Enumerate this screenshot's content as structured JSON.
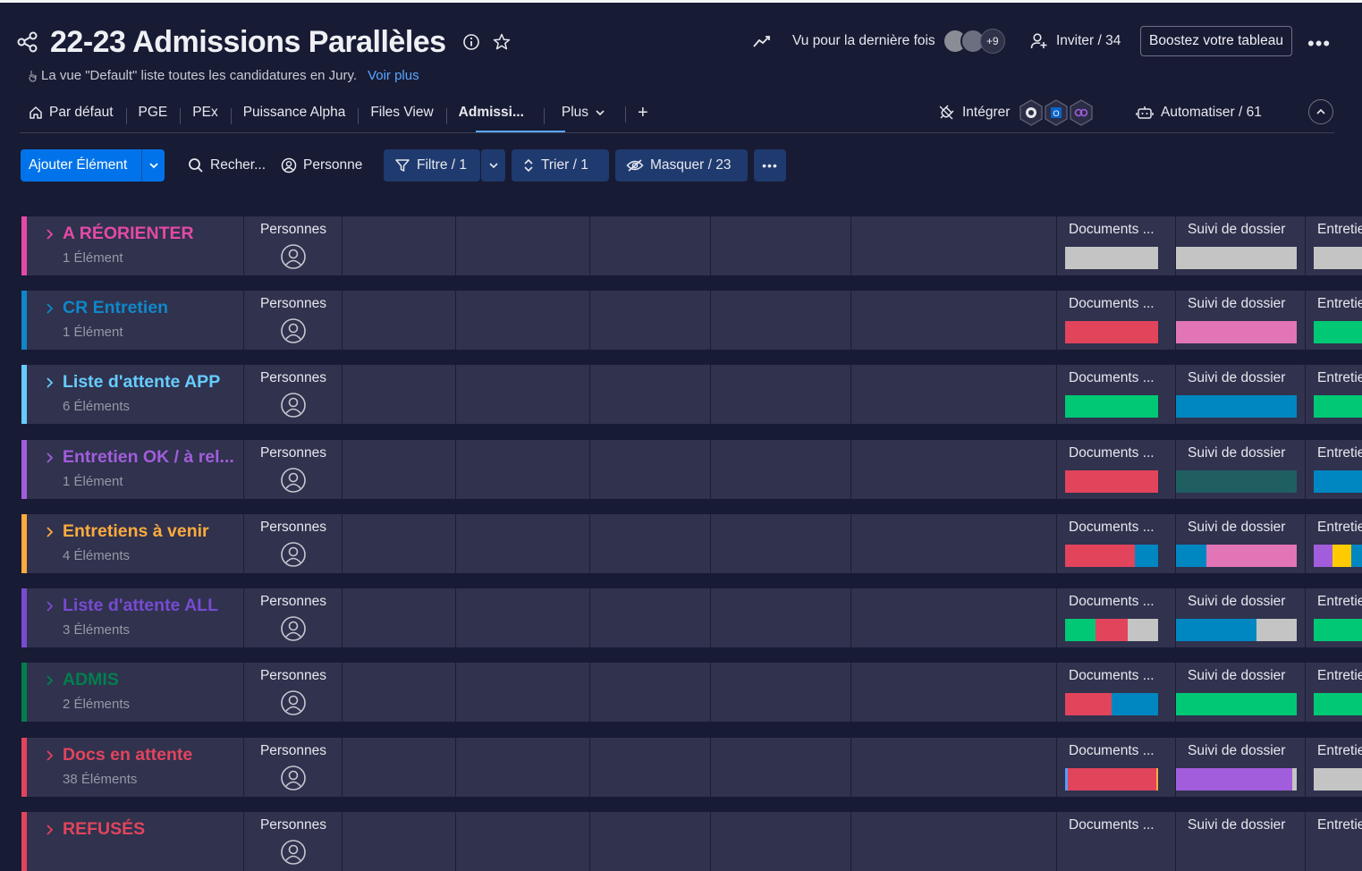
{
  "header": {
    "title": "22-23 Admissions Parallèles",
    "subtitle": "La vue \"Default\" liste toutes les candidatures en Jury.",
    "subtitle_link": "Voir plus",
    "last_seen": "Vu pour la dernière fois",
    "avatars_more": "+9",
    "invite": "Inviter / 34",
    "boost": "Boostez votre tableau"
  },
  "tabs": [
    {
      "label": "Par défaut",
      "icon": "home-icon"
    },
    {
      "label": "PGE"
    },
    {
      "label": "PEx"
    },
    {
      "label": "Puissance Alpha"
    },
    {
      "label": "Files View"
    },
    {
      "label": "Admissi...",
      "active": true
    },
    {
      "label": "Plus",
      "icon": "chevron-down-icon"
    }
  ],
  "tabs_add": "+",
  "integrate": "Intégrer",
  "automate": "Automatiser / 61",
  "toolbar": {
    "add": "Ajouter Élément",
    "search": "Recher...",
    "person": "Personne",
    "filter": "Filtre / 1",
    "sort": "Trier / 1",
    "hide": "Masquer / 23"
  },
  "columns": {
    "persons": "Personnes",
    "documents": "Documents ...",
    "tracking": "Suivi de dossier",
    "interview": "Entretie"
  },
  "colors": {
    "grey": "#c4c4c4",
    "red": "#e2445c",
    "pink": "#e175b5",
    "green": "#00c875",
    "blue": "#0086c0",
    "teal": "#1f5f62",
    "purple": "#a25ddc",
    "yellow": "#ffcb00",
    "accent": "#0073ea"
  },
  "groups": [
    {
      "name": "A RÉORIENTER",
      "count": "1 Élément",
      "color": "#e44aa5",
      "documents": [
        [
          "#c4c4c4",
          1
        ]
      ],
      "tracking": [
        [
          "#c4c4c4",
          1
        ]
      ],
      "interview": [
        [
          "#c4c4c4",
          1
        ]
      ]
    },
    {
      "name": "CR Entretien",
      "count": "1 Élément",
      "color": "#0f87c9",
      "documents": [
        [
          "#e2445c",
          1
        ]
      ],
      "tracking": [
        [
          "#e175b5",
          1
        ]
      ],
      "interview": [
        [
          "#00c875",
          1
        ]
      ]
    },
    {
      "name": "Liste d'attente APP",
      "count": "6 Éléments",
      "color": "#66ccff",
      "documents": [
        [
          "#00c875",
          1
        ]
      ],
      "tracking": [
        [
          "#0086c0",
          1
        ]
      ],
      "interview": [
        [
          "#00c875",
          1
        ]
      ]
    },
    {
      "name": "Entretien OK / à rel...",
      "count": "1 Élément",
      "color": "#a25ddc",
      "documents": [
        [
          "#e2445c",
          1
        ]
      ],
      "tracking": [
        [
          "#1f5f62",
          1
        ]
      ],
      "interview": [
        [
          "#0086c0",
          1
        ]
      ]
    },
    {
      "name": "Entretiens à venir",
      "count": "4 Éléments",
      "color": "#fdab3d",
      "documents": [
        [
          "#e2445c",
          0.75
        ],
        [
          "#0086c0",
          0.25
        ]
      ],
      "tracking": [
        [
          "#0086c0",
          0.25
        ],
        [
          "#e175b5",
          0.75
        ]
      ],
      "interview": [
        [
          "#a25ddc",
          0.35
        ],
        [
          "#ffcb00",
          0.35
        ],
        [
          "#0086c0",
          0.3
        ]
      ]
    },
    {
      "name": "Liste d'attente ALL",
      "count": "3 Éléments",
      "color": "#784bd1",
      "documents": [
        [
          "#00c875",
          0.33
        ],
        [
          "#e2445c",
          0.34
        ],
        [
          "#c4c4c4",
          0.33
        ]
      ],
      "tracking": [
        [
          "#0086c0",
          0.67
        ],
        [
          "#c4c4c4",
          0.33
        ]
      ],
      "interview": [
        [
          "#00c875",
          0.95
        ],
        [
          "#c4c4c4",
          0.05
        ]
      ]
    },
    {
      "name": "ADMIS",
      "count": "2 Éléments",
      "color": "#037f4c",
      "documents": [
        [
          "#e2445c",
          0.5
        ],
        [
          "#0086c0",
          0.5
        ]
      ],
      "tracking": [
        [
          "#00c875",
          1
        ]
      ],
      "interview": [
        [
          "#00c875",
          1
        ]
      ]
    },
    {
      "name": "Docs en attente",
      "count": "38 Éléments",
      "color": "#e2445c",
      "documents": [
        [
          "#579bfc",
          0.03
        ],
        [
          "#e2445c",
          0.95
        ],
        [
          "#fdab3d",
          0.02
        ]
      ],
      "tracking": [
        [
          "#a25ddc",
          0.96
        ],
        [
          "#c4c4c4",
          0.04
        ]
      ],
      "interview": [
        [
          "#c4c4c4",
          1
        ]
      ]
    },
    {
      "name": "REFUSÉS",
      "count": "",
      "color": "#e2445c",
      "documents": [],
      "tracking": [],
      "interview": []
    }
  ]
}
